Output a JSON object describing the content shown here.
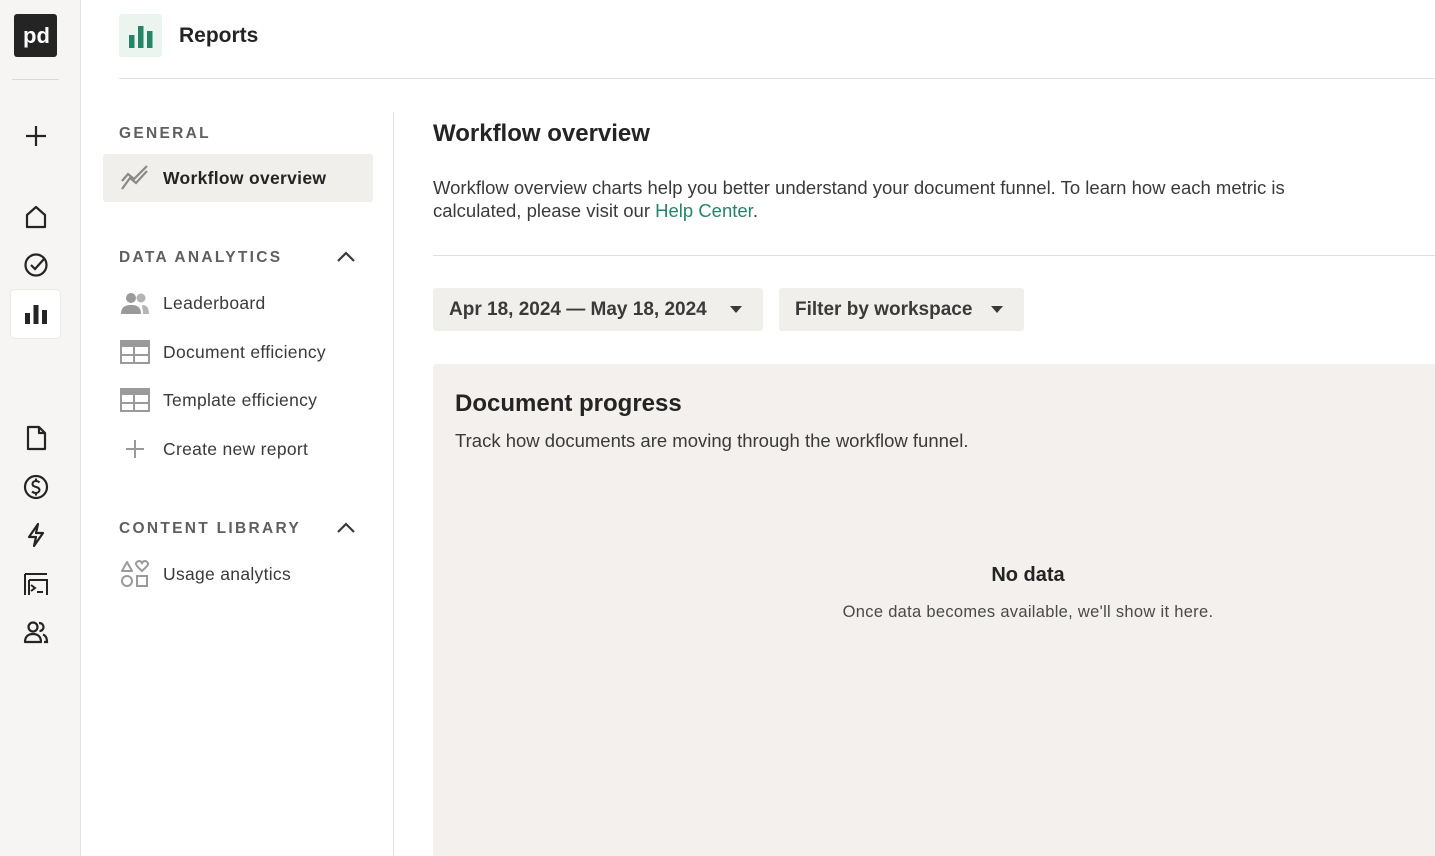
{
  "app": {
    "logo_text": "pd"
  },
  "rail": {
    "items": [
      {
        "icon": "plus-icon"
      },
      {
        "icon": "home-icon"
      },
      {
        "icon": "check-circle-icon"
      },
      {
        "icon": "bar-chart-icon",
        "active": true
      },
      {
        "icon": "document-icon"
      },
      {
        "icon": "dollar-icon"
      },
      {
        "icon": "lightning-icon"
      },
      {
        "icon": "forms-icon"
      },
      {
        "icon": "users-icon"
      }
    ]
  },
  "topbar": {
    "title": "Reports",
    "icon": "bar-chart-icon",
    "accent": "#248567"
  },
  "subnav": {
    "general": {
      "heading": "GENERAL",
      "items": [
        {
          "label": "Workflow overview",
          "icon": "trend-line-icon",
          "active": true
        }
      ]
    },
    "data_analytics": {
      "heading": "DATA ANALYTICS",
      "items": [
        {
          "label": "Leaderboard",
          "icon": "people-icon"
        },
        {
          "label": "Document efficiency",
          "icon": "table-icon"
        },
        {
          "label": "Template efficiency",
          "icon": "table-icon"
        },
        {
          "label": "Create new report",
          "icon": "plus-icon"
        }
      ]
    },
    "content_library": {
      "heading": "CONTENT LIBRARY",
      "items": [
        {
          "label": "Usage analytics",
          "icon": "shapes-icon"
        }
      ]
    }
  },
  "main": {
    "title": "Workflow overview",
    "description_prefix": "Workflow overview charts help you better understand your document funnel. To learn how each metric is calculated, please visit our ",
    "help_link": "Help Center",
    "description_suffix": ".",
    "date_range": "Apr 18, 2024 — May 18, 2024",
    "workspace_filter": "Filter by workspace",
    "panel": {
      "title": "Document progress",
      "subtitle": "Track how documents are moving through the workflow funnel.",
      "empty_title": "No data",
      "empty_message": "Once data becomes available, we'll show it here."
    }
  }
}
